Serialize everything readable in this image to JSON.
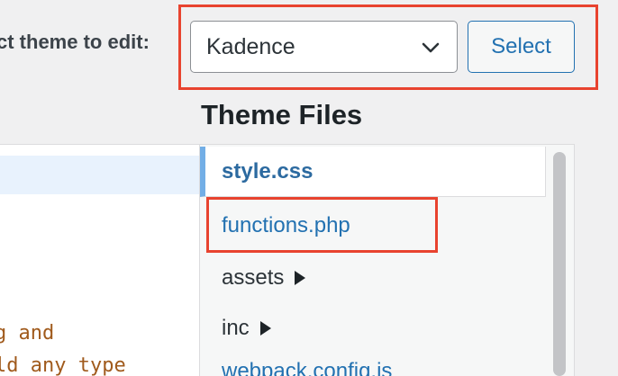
{
  "theme_selector": {
    "label": "ct theme to edit:",
    "selected_theme": "Kadence",
    "button_label": "Select"
  },
  "theme_files": {
    "heading": "Theme Files",
    "files": [
      {
        "name": "style.css",
        "type": "file",
        "current": true
      },
      {
        "name": "functions.php",
        "type": "file",
        "current": false
      },
      {
        "name": "assets",
        "type": "folder"
      },
      {
        "name": "inc",
        "type": "folder"
      },
      {
        "name": "webpack.config.js",
        "type": "file",
        "current": false
      }
    ]
  },
  "editor": {
    "lines": [
      "g and",
      "ld any type"
    ]
  },
  "colors": {
    "accent": "#2271b1",
    "annotation": "#e8432f",
    "code_comment": "#a05a1c"
  },
  "icons": {
    "select_chevron": "chevron-down-icon",
    "folder_arrow": "triangle-right-icon"
  }
}
